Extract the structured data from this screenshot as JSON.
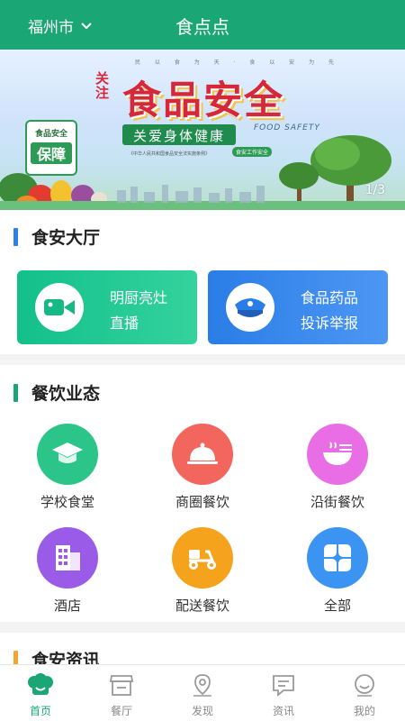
{
  "header": {
    "city": "福州市",
    "title": "食点点"
  },
  "banner": {
    "small_text": "民 以 食 为 天 · 食 以 安 为 先",
    "pre_text": "关注",
    "main_text": "食品安全",
    "sub_text": "关爱身体健康",
    "en_text": "FOOD SAFETY",
    "law_text": "《中华人民共和国食品安全法实施条例》",
    "law_tag": "食安工作安全",
    "badge_top": "食品安全",
    "badge_main": "保障",
    "counter": "1/3"
  },
  "hall": {
    "title": "食安大厅",
    "accent": "#2f7fe8",
    "cards": [
      {
        "line1": "明厨亮灶",
        "line2": "直播",
        "icon": "video-camera-icon",
        "color_from": "#13c08a",
        "color_to": "#34d29d"
      },
      {
        "line1": "食品药品",
        "line2": "投诉举报",
        "icon": "police-cap-icon",
        "color_from": "#2a7de6",
        "color_to": "#4d97f4"
      }
    ]
  },
  "dining": {
    "title": "餐饮业态",
    "accent": "#1aa775",
    "items": [
      {
        "label": "学校食堂",
        "icon": "graduation-cap-icon",
        "color": "#2bc58a"
      },
      {
        "label": "商圈餐饮",
        "icon": "food-cloche-icon",
        "color": "#f3665e"
      },
      {
        "label": "沿街餐饮",
        "icon": "noodle-bowl-icon",
        "color": "#e96ee6"
      },
      {
        "label": "酒店",
        "icon": "hotel-building-icon",
        "color": "#9a5ce8"
      },
      {
        "label": "配送餐饮",
        "icon": "delivery-scooter-icon",
        "color": "#f5a31c"
      },
      {
        "label": "全部",
        "icon": "four-petal-grid-icon",
        "color": "#3b94f2"
      }
    ]
  },
  "news": {
    "title": "食安资讯",
    "accent": "#f3a431"
  },
  "tabbar": {
    "active_color": "#1aa775",
    "items": [
      {
        "label": "首页",
        "icon": "home-chef-icon",
        "active": true
      },
      {
        "label": "餐厅",
        "icon": "restaurant-store-icon",
        "active": false
      },
      {
        "label": "发现",
        "icon": "location-pin-icon",
        "active": false
      },
      {
        "label": "资讯",
        "icon": "message-icon",
        "active": false
      },
      {
        "label": "我的",
        "icon": "smiley-profile-icon",
        "active": false
      }
    ]
  }
}
